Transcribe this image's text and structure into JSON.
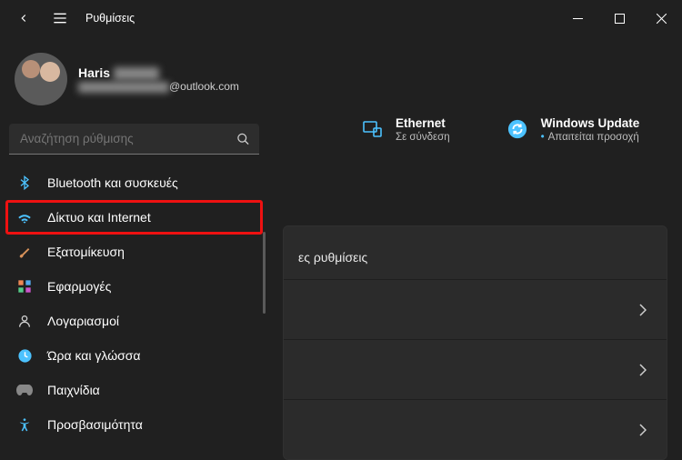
{
  "app": {
    "title": "Ρυθμίσεις"
  },
  "user": {
    "name_visible": "Haris",
    "name_redacted": "████",
    "email_redacted": "████████",
    "email_suffix": "@outlook.com"
  },
  "search": {
    "placeholder": "Αναζήτηση ρύθμισης"
  },
  "sidebar": {
    "items": [
      {
        "label": "Bluetooth και συσκευές",
        "icon": "bluetooth"
      },
      {
        "label": "Δίκτυο και Internet",
        "icon": "wifi",
        "highlighted": true
      },
      {
        "label": "Εξατομίκευση",
        "icon": "brush"
      },
      {
        "label": "Εφαρμογές",
        "icon": "apps"
      },
      {
        "label": "Λογαριασμοί",
        "icon": "person"
      },
      {
        "label": "Ώρα και γλώσσα",
        "icon": "time-lang"
      },
      {
        "label": "Παιχνίδια",
        "icon": "gaming"
      },
      {
        "label": "Προσβασιμότητα",
        "icon": "accessibility"
      }
    ]
  },
  "main": {
    "status": [
      {
        "icon": "ethernet",
        "title": "Ethernet",
        "sub": "Σε σύνδεση"
      },
      {
        "icon": "update",
        "title": "Windows Update",
        "sub": "Απαιτείται προσοχή",
        "dot": true
      }
    ],
    "panel_header_visible": "ες ρυθμίσεις"
  }
}
